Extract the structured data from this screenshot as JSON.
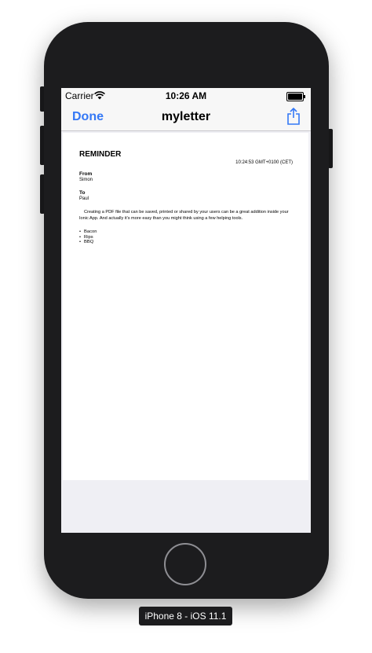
{
  "status_bar": {
    "carrier": "Carrier",
    "time": "10:26 AM",
    "wifi_icon": "wifi-icon",
    "battery_icon": "battery-icon"
  },
  "nav_bar": {
    "done_label": "Done",
    "title": "myletter",
    "share_icon": "share-icon",
    "accent_color": "#3478f6"
  },
  "document": {
    "heading": "REMINDER",
    "date": "10:24:53 GMT+0100 (CET)",
    "from_label": "From",
    "from_value": "Simon",
    "to_label": "To",
    "to_value": "Paul",
    "paragraph": "Creating a PDF file that can be saved, printed or shared by your users can be a great addition inside your Ionic App. And actually it's more easy than you might think using a few helping tools.",
    "list": [
      "Bacon",
      "Rips",
      "BBQ"
    ]
  },
  "device": {
    "label": "iPhone 8 - iOS 11.1"
  }
}
